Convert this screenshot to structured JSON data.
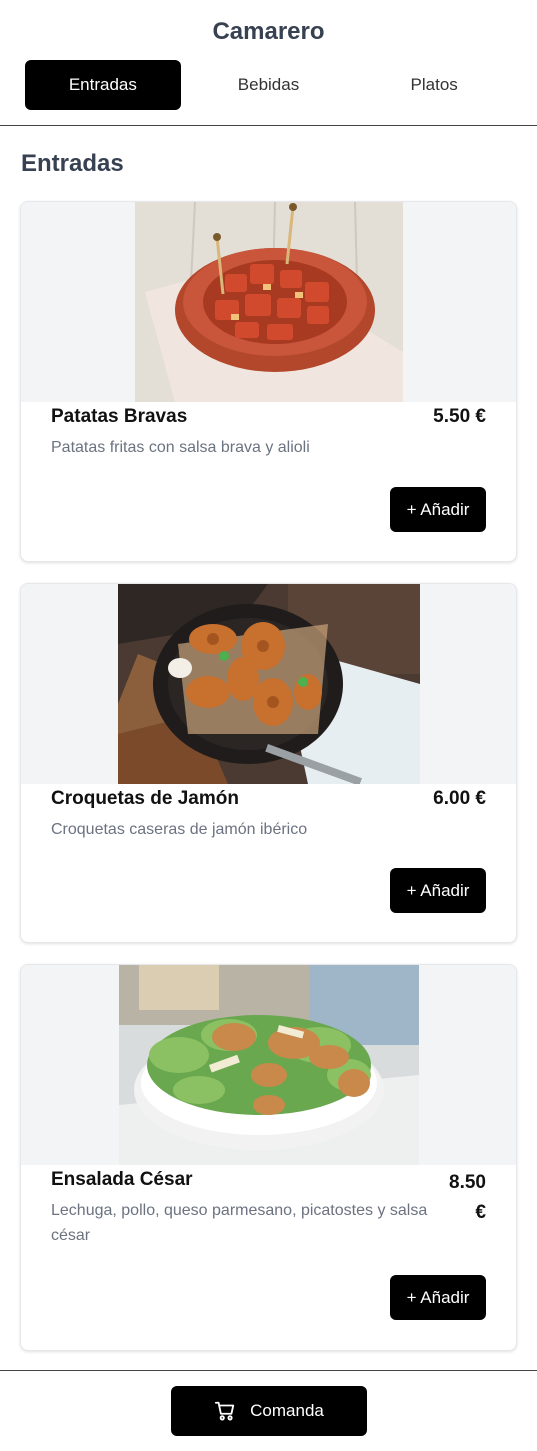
{
  "app": {
    "title": "Camarero"
  },
  "tabs": [
    {
      "label": "Entradas",
      "active": true
    },
    {
      "label": "Bebidas",
      "active": false
    },
    {
      "label": "Platos",
      "active": false
    }
  ],
  "section": {
    "title": "Entradas"
  },
  "items": [
    {
      "name": "Patatas Bravas",
      "price": "5.50 €",
      "description": "Patatas fritas con salsa brava y alioli",
      "add_label": "+ Añadir",
      "image_icon": "patatas-bravas-photo"
    },
    {
      "name": "Croquetas de Jamón",
      "price": "6.00 €",
      "description": "Croquetas caseras de jamón ibérico",
      "add_label": "+ Añadir",
      "image_icon": "croquetas-photo"
    },
    {
      "name": "Ensalada César",
      "price": "8.50 €",
      "description": "Lechuga, pollo, queso parmesano, picatostes y salsa césar",
      "add_label": "+ Añadir",
      "image_icon": "ensalada-cesar-photo"
    }
  ],
  "footer": {
    "order_label": "Comanda",
    "order_icon": "cart-icon"
  },
  "colors": {
    "accent": "#000000",
    "heading": "#374151",
    "muted": "#6b7280",
    "image_bg": "#f3f4f6"
  }
}
